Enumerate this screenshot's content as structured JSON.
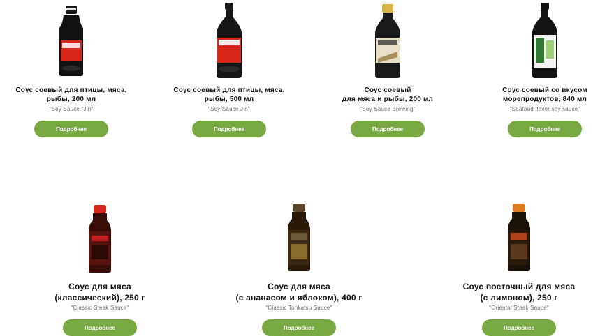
{
  "products": [
    {
      "title_lines": [
        "Соус соевый для птицы, мяса,",
        "рыбы, 200 мл"
      ],
      "subtitle": "\"Soy Sauce \"Jin\"",
      "button": "Подробнее",
      "image_icon": "soy-sauce-bottle-small-icon",
      "label_color": "#d9261c"
    },
    {
      "title_lines": [
        "Соус соевый для птицы, мяса,",
        "рыбы, 500 мл"
      ],
      "subtitle": "\"Soy Sauce Jin\"",
      "button": "Подробнее",
      "image_icon": "soy-sauce-bottle-large-icon",
      "label_color": "#d9261c"
    },
    {
      "title_lines": [
        "Соус соевый",
        "для мяса и рыбы, 200 мл"
      ],
      "subtitle": "\"Soy Sauce Brewing\"",
      "button": "Подробнее",
      "image_icon": "soy-sauce-brewing-bottle-icon",
      "label_color": "#e8dfc9"
    },
    {
      "title_lines": [
        "Соус соевый со вкусом",
        "морепродуктов, 840 мл"
      ],
      "subtitle": "\"Seafood flavor soy sauce\"",
      "button": "Подробнее",
      "image_icon": "seafood-soy-sauce-bottle-icon",
      "label_color": "#ffffff"
    },
    {
      "title_lines": [
        "Соус для мяса",
        "(классический), 250 г"
      ],
      "subtitle": "\"Classic Steak Sauce\"",
      "button": "Подробнее",
      "image_icon": "classic-steak-sauce-bottle-icon",
      "label_color": "#c01d1d"
    },
    {
      "title_lines": [
        "Соус для мяса",
        "(с ананасом и яблоком), 400 г"
      ],
      "subtitle": "\"Classic Tonkatsu Sauce\"",
      "button": "Подробнее",
      "image_icon": "tonkatsu-sauce-bottle-icon",
      "label_color": "#5a4a2a"
    },
    {
      "title_lines": [
        "Соус восточный для мяса",
        "(с лимоном), 250 г"
      ],
      "subtitle": "\"Oriental Steak Sauce\"",
      "button": "Подробнее",
      "image_icon": "oriental-steak-sauce-bottle-icon",
      "label_color": "#e07a1f"
    }
  ],
  "colors": {
    "button_bg": "#79a843",
    "button_text": "#ffffff",
    "title_text": "#111111",
    "subtitle_text": "#6b6b6b"
  }
}
